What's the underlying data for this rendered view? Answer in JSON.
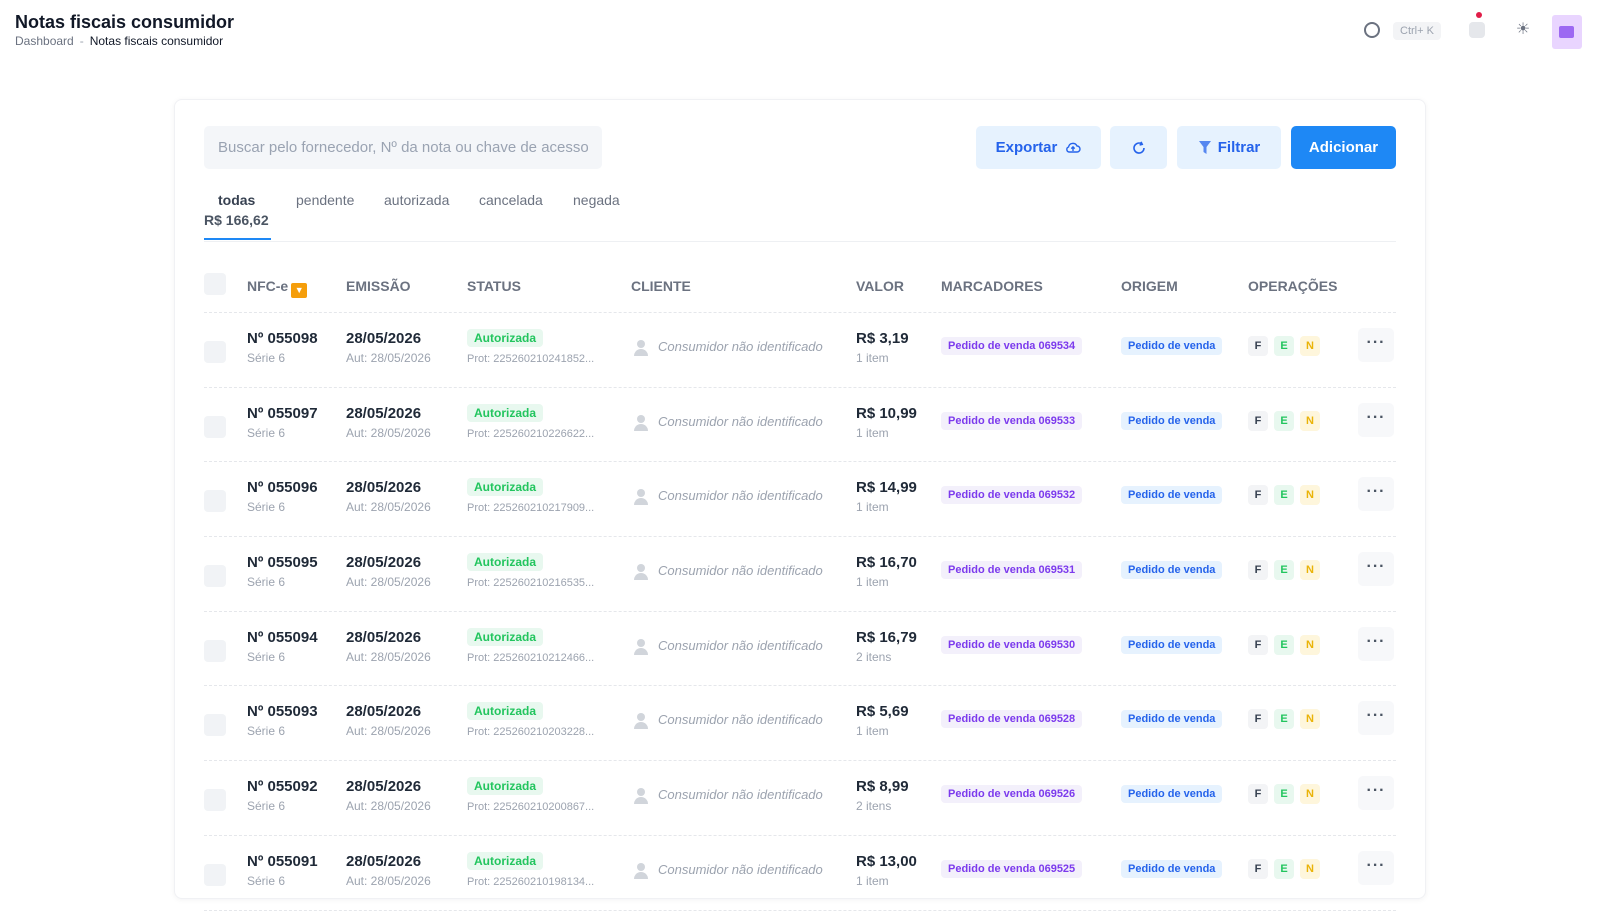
{
  "header": {
    "title": "Notas fiscais consumidor",
    "breadcrumb": {
      "root": "Dashboard",
      "separator": "-",
      "current": "Notas fiscais consumidor"
    },
    "shortcut": "Ctrl+ K"
  },
  "toolbar": {
    "search_placeholder": "Buscar pelo fornecedor, Nº da nota ou chave de acesso",
    "export_label": "Exportar",
    "filter_label": "Filtrar",
    "add_label": "Adicionar"
  },
  "tabs": {
    "items": [
      "todas",
      "pendente",
      "autorizada",
      "cancelada",
      "negada"
    ],
    "total": "R$ 166,62"
  },
  "table": {
    "headers": {
      "nfce": "NFC-e",
      "emissao": "EMISSÃO",
      "status": "STATUS",
      "cliente": "CLIENTE",
      "valor": "VALOR",
      "marcadores": "MARCADORES",
      "origem": "ORIGEM",
      "operacoes": "OPERAÇÕES"
    },
    "rows": [
      {
        "num": "Nº 055098",
        "serie": "Série 6",
        "date": "28/05/2026",
        "aut": "Aut: 28/05/2026",
        "status": "Autorizada",
        "prot": "Prot: 225260210241852...",
        "cliente": "Consumidor não identificado",
        "valor": "R$ 3,19",
        "itens": "1 item",
        "marcador": "Pedido de venda 069534",
        "origem": "Pedido de venda",
        "ops": [
          "F",
          "E",
          "N"
        ]
      },
      {
        "num": "Nº 055097",
        "serie": "Série 6",
        "date": "28/05/2026",
        "aut": "Aut: 28/05/2026",
        "status": "Autorizada",
        "prot": "Prot: 225260210226622...",
        "cliente": "Consumidor não identificado",
        "valor": "R$ 10,99",
        "itens": "1 item",
        "marcador": "Pedido de venda 069533",
        "origem": "Pedido de venda",
        "ops": [
          "F",
          "E",
          "N"
        ]
      },
      {
        "num": "Nº 055096",
        "serie": "Série 6",
        "date": "28/05/2026",
        "aut": "Aut: 28/05/2026",
        "status": "Autorizada",
        "prot": "Prot: 225260210217909...",
        "cliente": "Consumidor não identificado",
        "valor": "R$ 14,99",
        "itens": "1 item",
        "marcador": "Pedido de venda 069532",
        "origem": "Pedido de venda",
        "ops": [
          "F",
          "E",
          "N"
        ]
      },
      {
        "num": "Nº 055095",
        "serie": "Série 6",
        "date": "28/05/2026",
        "aut": "Aut: 28/05/2026",
        "status": "Autorizada",
        "prot": "Prot: 225260210216535...",
        "cliente": "Consumidor não identificado",
        "valor": "R$ 16,70",
        "itens": "1 item",
        "marcador": "Pedido de venda 069531",
        "origem": "Pedido de venda",
        "ops": [
          "F",
          "E",
          "N"
        ]
      },
      {
        "num": "Nº 055094",
        "serie": "Série 6",
        "date": "28/05/2026",
        "aut": "Aut: 28/05/2026",
        "status": "Autorizada",
        "prot": "Prot: 225260210212466...",
        "cliente": "Consumidor não identificado",
        "valor": "R$ 16,79",
        "itens": "2 itens",
        "marcador": "Pedido de venda 069530",
        "origem": "Pedido de venda",
        "ops": [
          "F",
          "E",
          "N"
        ]
      },
      {
        "num": "Nº 055093",
        "serie": "Série 6",
        "date": "28/05/2026",
        "aut": "Aut: 28/05/2026",
        "status": "Autorizada",
        "prot": "Prot: 225260210203228...",
        "cliente": "Consumidor não identificado",
        "valor": "R$ 5,69",
        "itens": "1 item",
        "marcador": "Pedido de venda 069528",
        "origem": "Pedido de venda",
        "ops": [
          "F",
          "E",
          "N"
        ]
      },
      {
        "num": "Nº 055092",
        "serie": "Série 6",
        "date": "28/05/2026",
        "aut": "Aut: 28/05/2026",
        "status": "Autorizada",
        "prot": "Prot: 225260210200867...",
        "cliente": "Consumidor não identificado",
        "valor": "R$ 8,99",
        "itens": "2 itens",
        "marcador": "Pedido de venda 069526",
        "origem": "Pedido de venda",
        "ops": [
          "F",
          "E",
          "N"
        ]
      },
      {
        "num": "Nº 055091",
        "serie": "Série 6",
        "date": "28/05/2026",
        "aut": "Aut: 28/05/2026",
        "status": "Autorizada",
        "prot": "Prot: 225260210198134...",
        "cliente": "Consumidor não identificado",
        "valor": "R$ 13,00",
        "itens": "1 item",
        "marcador": "Pedido de venda 069525",
        "origem": "Pedido de venda",
        "ops": [
          "F",
          "E",
          "N"
        ]
      }
    ]
  }
}
